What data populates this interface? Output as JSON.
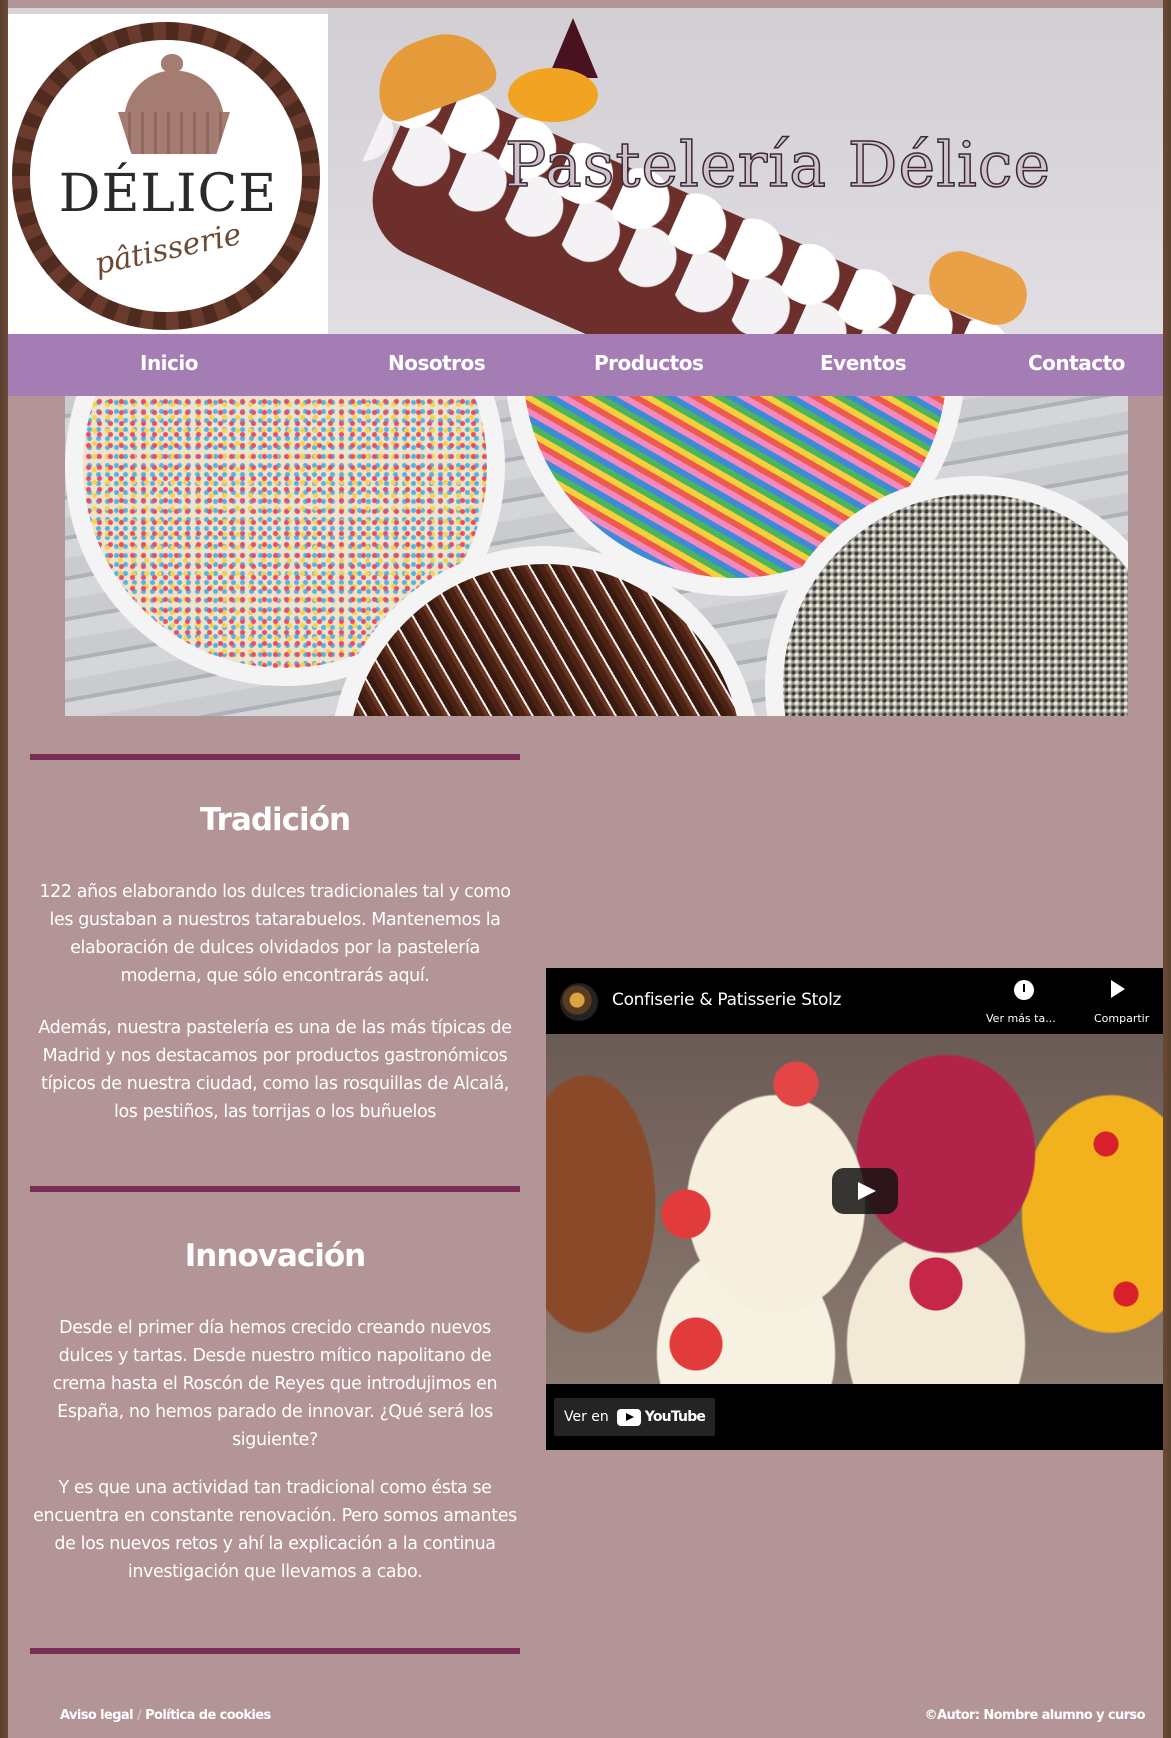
{
  "brand": {
    "logo_word": "DÉLICE",
    "logo_sub": "pâtisserie",
    "hero_title": "Pastelería Délice"
  },
  "nav": {
    "items": [
      {
        "label": "Inicio"
      },
      {
        "label": "Nosotros"
      },
      {
        "label": "Productos"
      },
      {
        "label": "Eventos"
      },
      {
        "label": "Contacto"
      }
    ]
  },
  "sections": {
    "tradicion": {
      "title": "Tradición",
      "paragraphs": [
        "122 años elaborando los dulces tradicionales tal y como les gustaban a nuestros tatarabuelos. Mantenemos la elaboración de dulces olvidados por la pastelería moderna, que sólo encontrarás aquí.",
        "Además, nuestra pastelería es una de las más típicas de Madrid y nos destacamos por productos gastronómicos típicos de nuestra ciudad, como las rosquillas de Alcalá, los pestiños, las torrijas o los buñuelos"
      ]
    },
    "innovacion": {
      "title": "Innovación",
      "paragraphs": [
        "Desde el primer día hemos crecido creando nuevos dulces y tartas. Desde nuestro mítico napolitano de crema hasta el Roscón de Reyes que introdujimos en España, no hemos parado de innovar. ¿Qué será los siguiente?",
        "Y es que una actividad tan tradicional como ésta se encuentra en constante renovación. Pero somos amantes de los nuevos retos y ahí la explicación a la continua investigación que llevamos a cabo."
      ]
    }
  },
  "video": {
    "channel": "Confiserie & Patisserie Stolz",
    "watch_later": "Ver más ta...",
    "share": "Compartir",
    "watch_on": "Ver en",
    "platform": "YouTube"
  },
  "footer": {
    "legal": "Aviso legal",
    "separator": "/",
    "cookies": "Política de cookies",
    "author": "©Autor: Nombre alumno y curso"
  },
  "colors": {
    "page_bg": "#b39497",
    "nav_bg": "#a57db5",
    "rule": "#7a2c52"
  }
}
